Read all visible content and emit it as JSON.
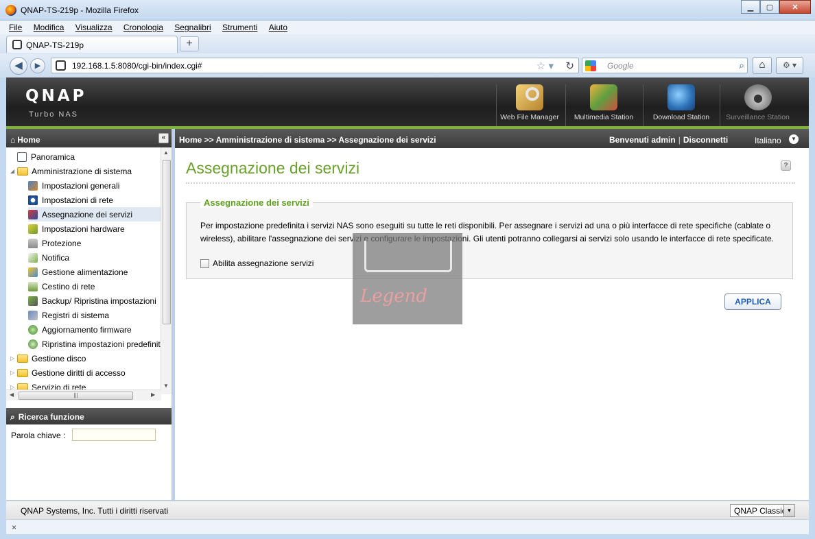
{
  "browser": {
    "window_title": "QNAP-TS-219p - Mozilla Firefox",
    "menu": [
      "File",
      "Modifica",
      "Visualizza",
      "Cronologia",
      "Segnalibri",
      "Strumenti",
      "Aiuto"
    ],
    "tab_label": "QNAP-TS-219p",
    "url": "192.168.1.5:8080/cgi-bin/index.cgi#",
    "search_placeholder": "Google",
    "status": "×"
  },
  "header": {
    "logo": "QNAP",
    "subtitle": "Turbo NAS",
    "apps": [
      {
        "label": "Web File Manager",
        "icon": "web-file-manager-icon"
      },
      {
        "label": "Multimedia Station",
        "icon": "multimedia-station-icon"
      },
      {
        "label": "Download Station",
        "icon": "download-station-icon"
      },
      {
        "label": "Surveillance Station",
        "icon": "surveillance-station-icon"
      }
    ]
  },
  "sidebar": {
    "title": "Home",
    "items": [
      {
        "label": "Panoramica",
        "level": 0
      },
      {
        "label": "Amministrazione di sistema",
        "level": 0
      },
      {
        "label": "Impostazioni generali",
        "level": 1
      },
      {
        "label": "Impostazioni di rete",
        "level": 1
      },
      {
        "label": "Assegnazione dei servizi",
        "level": 1
      },
      {
        "label": "Impostazioni hardware",
        "level": 1
      },
      {
        "label": "Protezione",
        "level": 1
      },
      {
        "label": "Notifica",
        "level": 1
      },
      {
        "label": "Gestione alimentazione",
        "level": 1
      },
      {
        "label": "Cestino di rete",
        "level": 1
      },
      {
        "label": "Backup/ Ripristina impostazioni",
        "level": 1
      },
      {
        "label": "Registri di sistema",
        "level": 1
      },
      {
        "label": "Aggiornamento firmware",
        "level": 1
      },
      {
        "label": "Ripristina impostazioni predefinite",
        "level": 1
      },
      {
        "label": "Gestione disco",
        "level": 0
      },
      {
        "label": "Gestione diritti di accesso",
        "level": 0
      },
      {
        "label": "Servizio di rete",
        "level": 0
      }
    ],
    "search_title": "Ricerca funzione",
    "keyword_label": "Parola chiave :",
    "keyword_value": ""
  },
  "main": {
    "breadcrumb": "Home >> Amministrazione di sistema >> Assegnazione dei servizi",
    "welcome": "Benvenuti admin",
    "logout": "Disconnetti",
    "language": "Italiano",
    "page_title": "Assegnazione dei servizi",
    "section_title": "Assegnazione dei servizi",
    "description": "Per impostazione predefinita i servizi NAS sono eseguiti su tutte le reti disponibili. Per assegnare i servizi ad una o più interfacce di rete specifiche (cablate o wireless), abilitare l'assegnazione dei servizi e configurare le impostazioni. Gli utenti potranno collegarsi ai servizi solo usando le interfacce di rete specificate.",
    "checkbox_label": "Abilita assegnazione servizi",
    "checkbox_checked": false,
    "apply_label": "APPLICA"
  },
  "watermark": {
    "text": "Legend"
  },
  "footer": {
    "copyright": "QNAP Systems, Inc. Tutti i diritti riservati",
    "theme": "QNAP Classic"
  }
}
